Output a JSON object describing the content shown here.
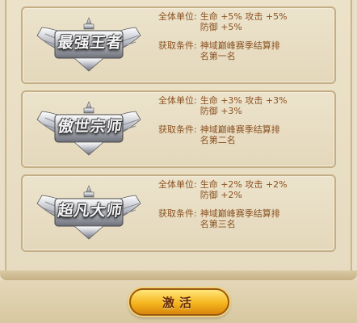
{
  "cards": [
    {
      "badge": "最强王者",
      "scope_label": "全体单位:",
      "stats_line1": "生命 +5% 攻击 +5%",
      "stats_line2": "防御 +5%",
      "cond_label": "获取条件:",
      "cond_line1": "神域巅峰赛季结算排",
      "cond_line2": "名第一名"
    },
    {
      "badge": "傲世宗师",
      "scope_label": "全体单位:",
      "stats_line1": "生命 +3% 攻击 +3%",
      "stats_line2": "防御 +3%",
      "cond_label": "获取条件:",
      "cond_line1": "神域巅峰赛季结算排",
      "cond_line2": "名第二名"
    },
    {
      "badge": "超凡大师",
      "scope_label": "全体单位:",
      "stats_line1": "生命 +2% 攻击 +2%",
      "stats_line2": "防御 +2%",
      "cond_label": "获取条件:",
      "cond_line1": "神域巅峰赛季结算排",
      "cond_line2": "名第三名"
    }
  ],
  "activate_label": "激活",
  "colors": {
    "text": "#8a5020",
    "card_border": "#c3ae86",
    "button_gold": "#f5b51e"
  }
}
